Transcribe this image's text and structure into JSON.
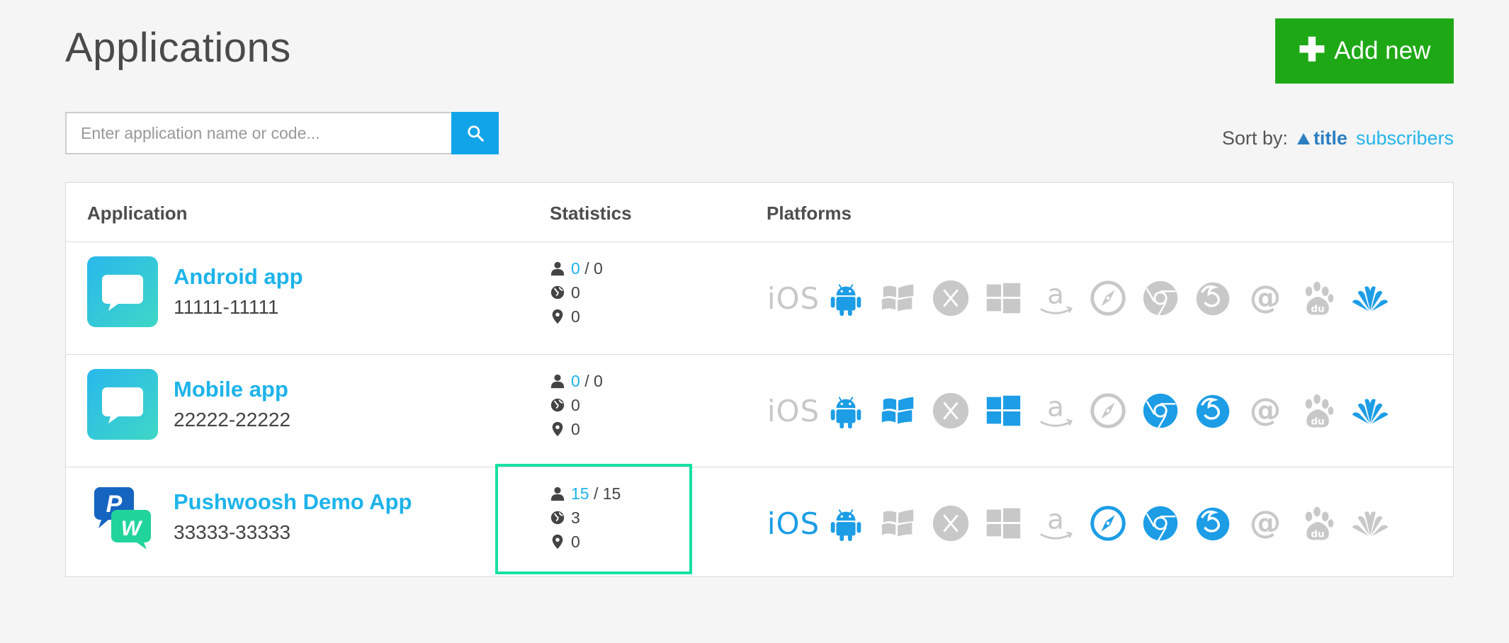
{
  "page": {
    "title": "Applications"
  },
  "add_button": {
    "label": "Add new"
  },
  "search": {
    "placeholder": "Enter application name or code..."
  },
  "sort": {
    "label": "Sort by:",
    "title_option": "title",
    "subscribers_option": "subscribers"
  },
  "table": {
    "headers": {
      "application": "Application",
      "statistics": "Statistics",
      "platforms": "Platforms"
    },
    "rows": [
      {
        "name": "Android app",
        "code": "11111-11111",
        "subscribers_active": "0",
        "subscribers_total": "/ 0",
        "countries": "0",
        "locations": "0",
        "platforms_active": [
          "android",
          "huawei"
        ]
      },
      {
        "name": "Mobile app",
        "code": "22222-22222",
        "subscribers_active": "0",
        "subscribers_total": "/ 0",
        "countries": "0",
        "locations": "0",
        "platforms_active": [
          "android",
          "windows-phone",
          "windows",
          "chrome",
          "firefox",
          "huawei"
        ]
      },
      {
        "name": "Pushwoosh Demo App",
        "code": "33333-33333",
        "subscribers_active": "15",
        "subscribers_total": "/ 15",
        "countries": "3",
        "locations": "0",
        "platforms_active": [
          "ios",
          "android",
          "safari",
          "chrome",
          "firefox"
        ]
      }
    ]
  },
  "platform_list": [
    "ios",
    "android",
    "windows-phone",
    "macos",
    "windows",
    "amazon",
    "safari",
    "chrome",
    "firefox",
    "email",
    "baidu",
    "huawei"
  ],
  "platform_text": {
    "ios": "iOS"
  },
  "colors": {
    "accent": "#1db3ea",
    "add_green": "#1ea816",
    "search_blue": "#12a4e8",
    "inactive": "#c8c8c8",
    "active_platform": "#1c9de6",
    "highlight": "#18e0a3"
  }
}
